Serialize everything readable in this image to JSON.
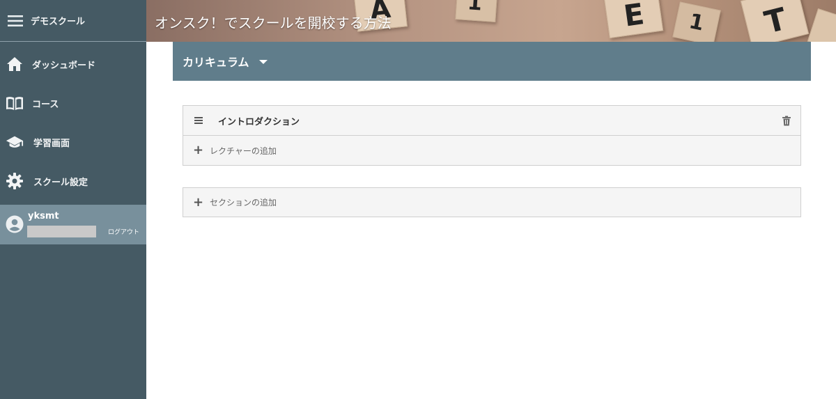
{
  "sidebar": {
    "school_name": "デモスクール",
    "items": [
      {
        "label": "ダッシュボード",
        "icon": "home-icon"
      },
      {
        "label": "コース",
        "icon": "book-icon"
      },
      {
        "label": "学習画面",
        "icon": "graduation-cap-icon"
      },
      {
        "label": "スクール設定",
        "icon": "gear-icon"
      }
    ],
    "user": {
      "name": "yksmt",
      "logout_label": "ログアウト",
      "icon": "account-circle-icon"
    }
  },
  "banner": {
    "title": "オンスク！でスクールを開校する方法"
  },
  "curriculum": {
    "header_label": "カリキュラム",
    "sections": [
      {
        "title": "イントロダクション",
        "add_lecture_label": "レクチャーの追加"
      }
    ],
    "add_section_label": "セクションの追加"
  },
  "colors": {
    "sidebar_bg": "#455a64",
    "user_bg": "#78909c",
    "panel_header": "#607d8b"
  }
}
